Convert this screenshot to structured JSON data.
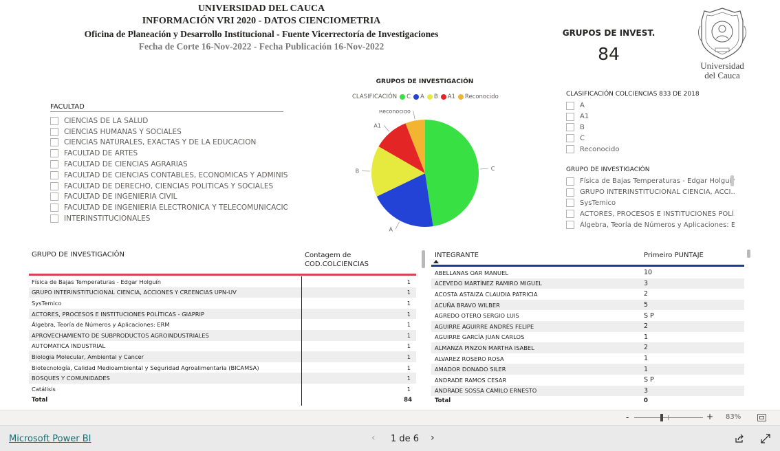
{
  "header": {
    "line1": "UNIVERSIDAD DEL CAUCA",
    "line2": "INFORMACIÓN VRI  2020 - DATOS CIENCIOMETRIA",
    "line3": "Oficina de Planeación y Desarrollo Institucional - Fuente Vicerrectoría de Investigaciones",
    "line4": "Fecha de Corte 16-Nov-2022 - Fecha Publicación 16-Nov-2022"
  },
  "card": {
    "label": "GRUPOS DE INVEST.",
    "value": "84"
  },
  "logo": {
    "line1": "Universidad",
    "line2": "del Cauca"
  },
  "facultad_slicer": {
    "title": "FACULTAD",
    "items": [
      "CIENCIAS DE LA SALUD",
      "CIENCIAS HUMANAS Y SOCIALES",
      "CIENCIAS NATURALES, EXACTAS Y DE LA EDUCACION",
      "FACULTAD DE ARTES",
      "FACULTAD DE CIENCIAS AGRARIAS",
      "FACULTAD DE CIENCIAS CONTABLES, ECONOMICAS Y ADMINIST...",
      "FACULTAD DE DERECHO, CIENCIAS POLITICAS Y SOCIALES",
      "FACULTAD DE INGENIERIA CIVIL",
      "FACULTAD DE INGENIERIA ELECTRONICA Y TELECOMUNICACIONES",
      "INTERINSTITUCIONALES"
    ]
  },
  "clasif_slicer": {
    "title": "CLASIFICACIÓN COLCIENCIAS 833 DE 2018",
    "items": [
      "A",
      "A1",
      "B",
      "C",
      "Reconocido"
    ]
  },
  "grupo_slicer": {
    "title": "GRUPO DE INVESTIGACIÓN",
    "items": [
      "Física de Bajas Temperaturas - Edgar Holguín",
      "GRUPO INTERINSTITUCIONAL CIENCIA, ACCI...",
      "SysTemico",
      "ACTORES, PROCESOS E INSTITUCIONES POLÍ...",
      "Álgebra, Teoría de Números y Aplicaciones: E..."
    ]
  },
  "chart_data": {
    "type": "pie",
    "title": "GRUPOS DE INVESTIGACIÓN",
    "legend_title": "CLASIFICACIÓN",
    "legend_position": "top",
    "categories": [
      "C",
      "A",
      "B",
      "A1",
      "Reconocido"
    ],
    "values": [
      40,
      17,
      13,
      9,
      5
    ],
    "colors": [
      "#39e043",
      "#2243d6",
      "#e6ea3e",
      "#e42525",
      "#f2b431"
    ]
  },
  "table1": {
    "col1": "GRUPO DE INVESTIGACIÓN",
    "col2": "Contagem de COD.COLCIENCIAS",
    "accent": "#d64550",
    "rows": [
      {
        "name": "Física de Bajas Temperaturas - Edgar Holguín",
        "value": "1"
      },
      {
        "name": "GRUPO INTERINSTITUCIONAL CIENCIA, ACCIONES Y CREENCIAS UPN-UV",
        "value": "1"
      },
      {
        "name": "SysTemico",
        "value": "1"
      },
      {
        "name": "ACTORES, PROCESOS E INSTITUCIONES POLÍTICAS - GIAPRIP",
        "value": "1"
      },
      {
        "name": "Álgebra, Teoría de Números y Aplicaciones: ERM",
        "value": "1"
      },
      {
        "name": "APROVECHAMIENTO DE SUBPRODUCTOS AGROINDUSTRIALES",
        "value": "1"
      },
      {
        "name": "AUTOMATICA INDUSTRIAL",
        "value": "1"
      },
      {
        "name": "Biologia Molecular, Ambiental y Cancer",
        "value": "1"
      },
      {
        "name": "Biotecnología, Calidad Medioambiental y Seguridad Agroalimentaria (BICAMSA)",
        "value": "1"
      },
      {
        "name": "BOSQUES Y COMUNIDADES",
        "value": "1"
      },
      {
        "name": "Catálisis",
        "value": "1"
      }
    ],
    "total_label": "Total",
    "total_value": "84"
  },
  "table2": {
    "col1": "INTEGRANTE",
    "col2": "Primeiro PUNTAJE",
    "accent": "#1f3a93",
    "rows": [
      {
        "name": "ABELLANAS OAR MANUEL",
        "value": "10"
      },
      {
        "name": "ACEVEDO MARTÍNEZ RAMIRO MIGUEL",
        "value": "3"
      },
      {
        "name": "ACOSTA ASTAIZA CLAUDIA PATRICIA",
        "value": "2"
      },
      {
        "name": "ACUÑA BRAVO WILBER",
        "value": "5"
      },
      {
        "name": "AGREDO OTERO SERGIO LUIS",
        "value": "S P"
      },
      {
        "name": "AGUIRRE AGUIRRE ANDRÉS FELIPE",
        "value": "2"
      },
      {
        "name": "AGUIRRE GARCÍA JUAN CARLOS",
        "value": "1"
      },
      {
        "name": "ALMANZA PINZON MARTHA ISABEL",
        "value": "2"
      },
      {
        "name": "ALVAREZ ROSERO ROSA",
        "value": "1"
      },
      {
        "name": "AMADOR DONADO SILER",
        "value": "1"
      },
      {
        "name": "ANDRADE RAMOS CESAR",
        "value": "S P"
      },
      {
        "name": "ANDRADE SOSSA CAMILO ERNESTO",
        "value": "3"
      }
    ],
    "total_label": "Total",
    "total_value": "0"
  },
  "zoom": {
    "minus": "-",
    "plus": "+",
    "level": "83%",
    "fraction": 0.5
  },
  "footer": {
    "brand": "Microsoft Power BI",
    "page_indicator": "1 de 6"
  }
}
